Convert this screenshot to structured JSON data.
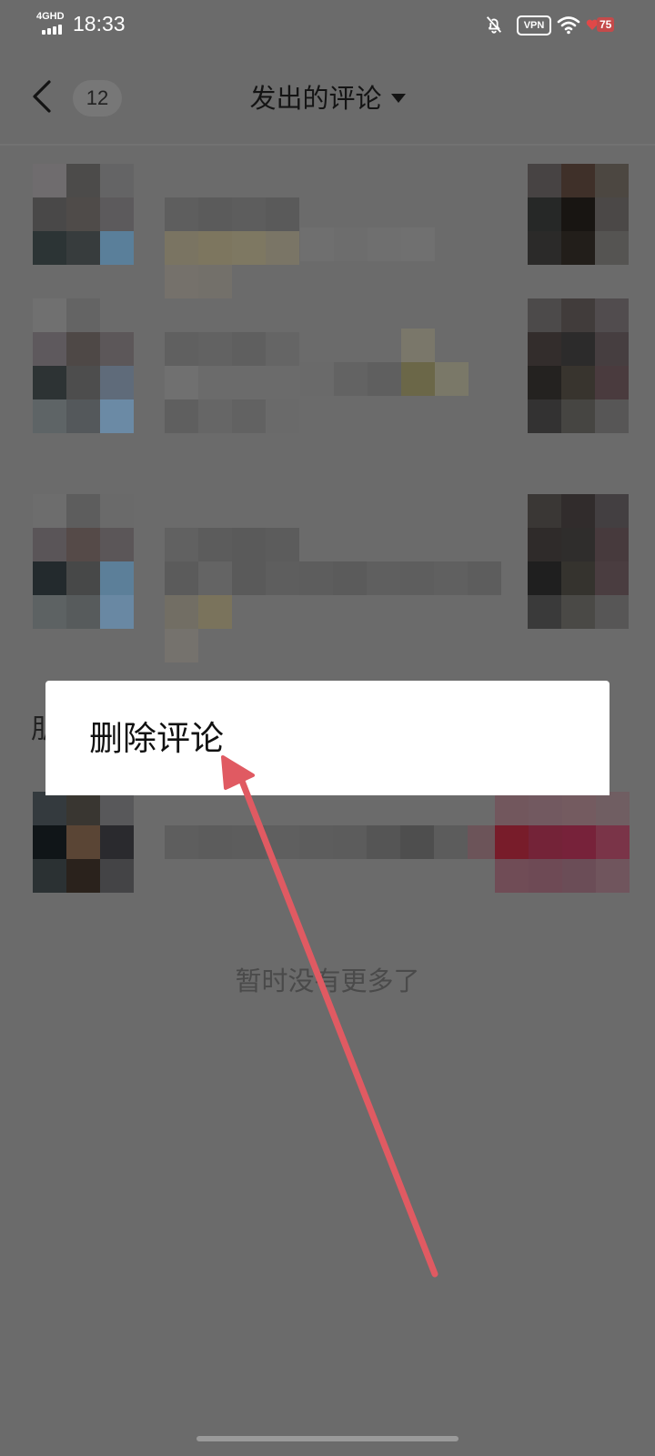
{
  "status_bar": {
    "network": "4GHD",
    "time": "18:33",
    "vpn": "VPN",
    "battery": "75"
  },
  "header": {
    "count": "12",
    "title": "发出的评论"
  },
  "context_menu": {
    "delete_label": "删除评论"
  },
  "list": {
    "footer": "暂时没有更多了"
  },
  "partial_text": "朋",
  "icons": {
    "back": "chevron-left-icon",
    "dropdown": "caret-down-icon",
    "mute": "bell-off-icon",
    "wifi": "wifi-icon",
    "battery": "heart-icon"
  },
  "colors": {
    "overlay_bg": "#6b6b6b",
    "menu_bg": "#ffffff",
    "arrow": "#e05a62",
    "title_text": "#141414"
  }
}
